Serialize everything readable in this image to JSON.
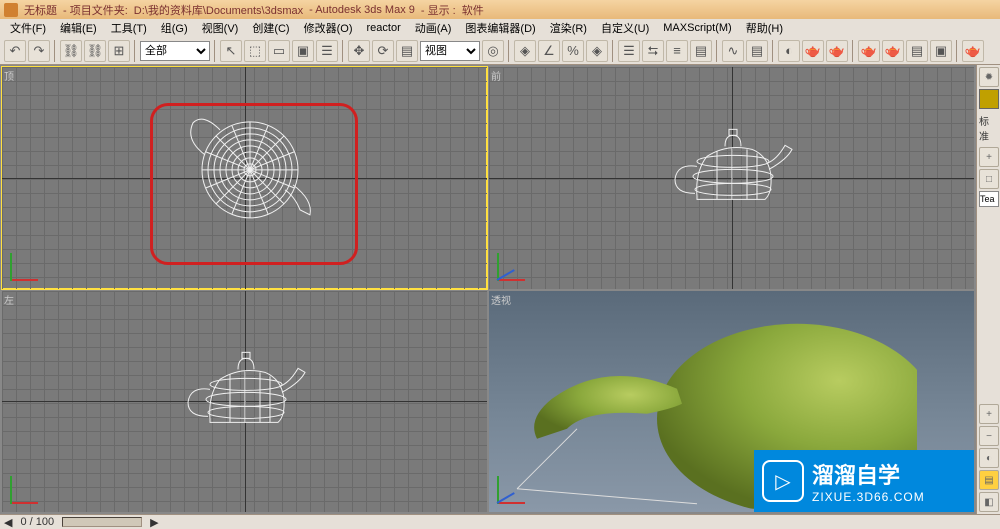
{
  "title": {
    "doc": "无标题",
    "project_label": "- 项目文件夹: ",
    "project_path": "D:\\我的资料库\\Documents\\3dsmax",
    "app": "- Autodesk 3ds Max 9",
    "display_label": "- 显示 : ",
    "display_driver": "软件"
  },
  "menus": [
    "文件(F)",
    "编辑(E)",
    "工具(T)",
    "组(G)",
    "视图(V)",
    "创建(C)",
    "修改器(O)",
    "reactor",
    "动画(A)",
    "图表编辑器(D)",
    "渲染(R)",
    "自定义(U)",
    "MAXScript(M)",
    "帮助(H)"
  ],
  "dropdowns": {
    "selection_filter": "全部",
    "ref_coord": "视图"
  },
  "viewport_labels": {
    "top": "顶",
    "front": "前",
    "left": "左",
    "persp": "透视"
  },
  "side_panel": {
    "preset_label": "标准",
    "object_input": "Tea"
  },
  "statusbar": {
    "frame": "0 / 100"
  },
  "watermark": {
    "text1": "溜溜自学",
    "text2": "ZIXUE.3D66.COM"
  },
  "icons": {
    "undo": "↶",
    "redo": "↷",
    "link": "⛓",
    "unlink": "⛓",
    "bind": "⊞",
    "cursor": "↖",
    "sel": "⬚",
    "rect": "▭",
    "window": "▣",
    "byname": "☰",
    "move": "✥",
    "rotate": "⟳",
    "scale": "▤",
    "pivot": "◎",
    "snap": "◈",
    "angle": "∠",
    "percent": "%",
    "mirror": "⮀",
    "align": "≡",
    "layers": "▤",
    "curve": "∿",
    "render": "🫖",
    "mat": "◐"
  }
}
